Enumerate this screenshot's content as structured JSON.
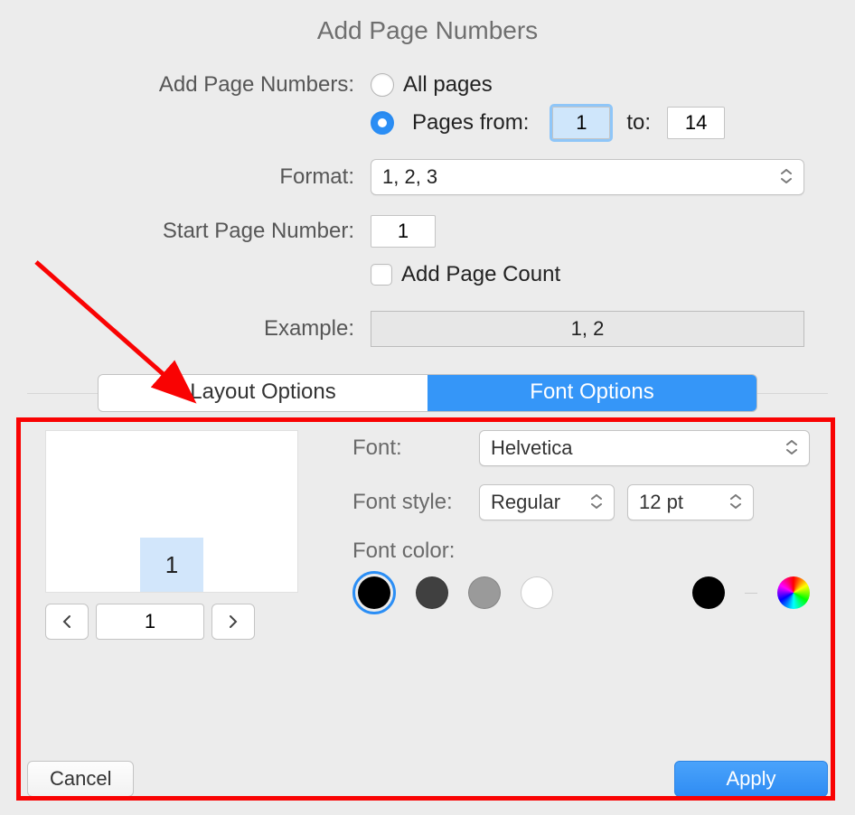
{
  "title": "Add Page Numbers",
  "labels": {
    "addPageNumbers": "Add Page Numbers:",
    "allPages": "All pages",
    "pagesFrom": "Pages from:",
    "to": "to:",
    "format": "Format:",
    "startPageNumber": "Start Page Number:",
    "addPageCount": "Add Page Count",
    "example": "Example:",
    "font": "Font:",
    "fontStyle": "Font style:",
    "fontColor": "Font color:"
  },
  "values": {
    "fromPage": "1",
    "toPage": "14",
    "formatSelected": "1, 2, 3",
    "startNumber": "1",
    "exampleText": "1, 2",
    "previewNumber": "1",
    "currentPreviewPage": "1",
    "fontName": "Helvetica",
    "fontStyle": "Regular",
    "fontSize": "12 pt"
  },
  "tabs": {
    "layout": "Layout Options",
    "font": "Font Options"
  },
  "buttons": {
    "cancel": "Cancel",
    "apply": "Apply"
  },
  "swatches": [
    "#000000",
    "#404040",
    "#9a9a9a",
    "#ffffff",
    "#000000"
  ],
  "selectedSwatchIndex": 0
}
